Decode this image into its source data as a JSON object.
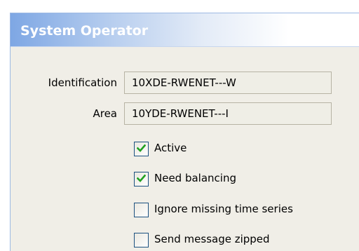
{
  "dialog": {
    "title": "System Operator"
  },
  "form": {
    "identification": {
      "label": "Identification",
      "value": "10XDE-RWENET---W"
    },
    "area": {
      "label": "Area",
      "value": "10YDE-RWENET---I"
    }
  },
  "options": [
    {
      "label": "Active",
      "checked": true
    },
    {
      "label": "Need balancing",
      "checked": true
    },
    {
      "label": "Ignore missing time series",
      "checked": false
    },
    {
      "label": "Send message zipped",
      "checked": false
    }
  ],
  "colors": {
    "check": "#21a121",
    "title_gradient_start": "#7ea7e4",
    "checkbox_border": "#1c5180"
  }
}
